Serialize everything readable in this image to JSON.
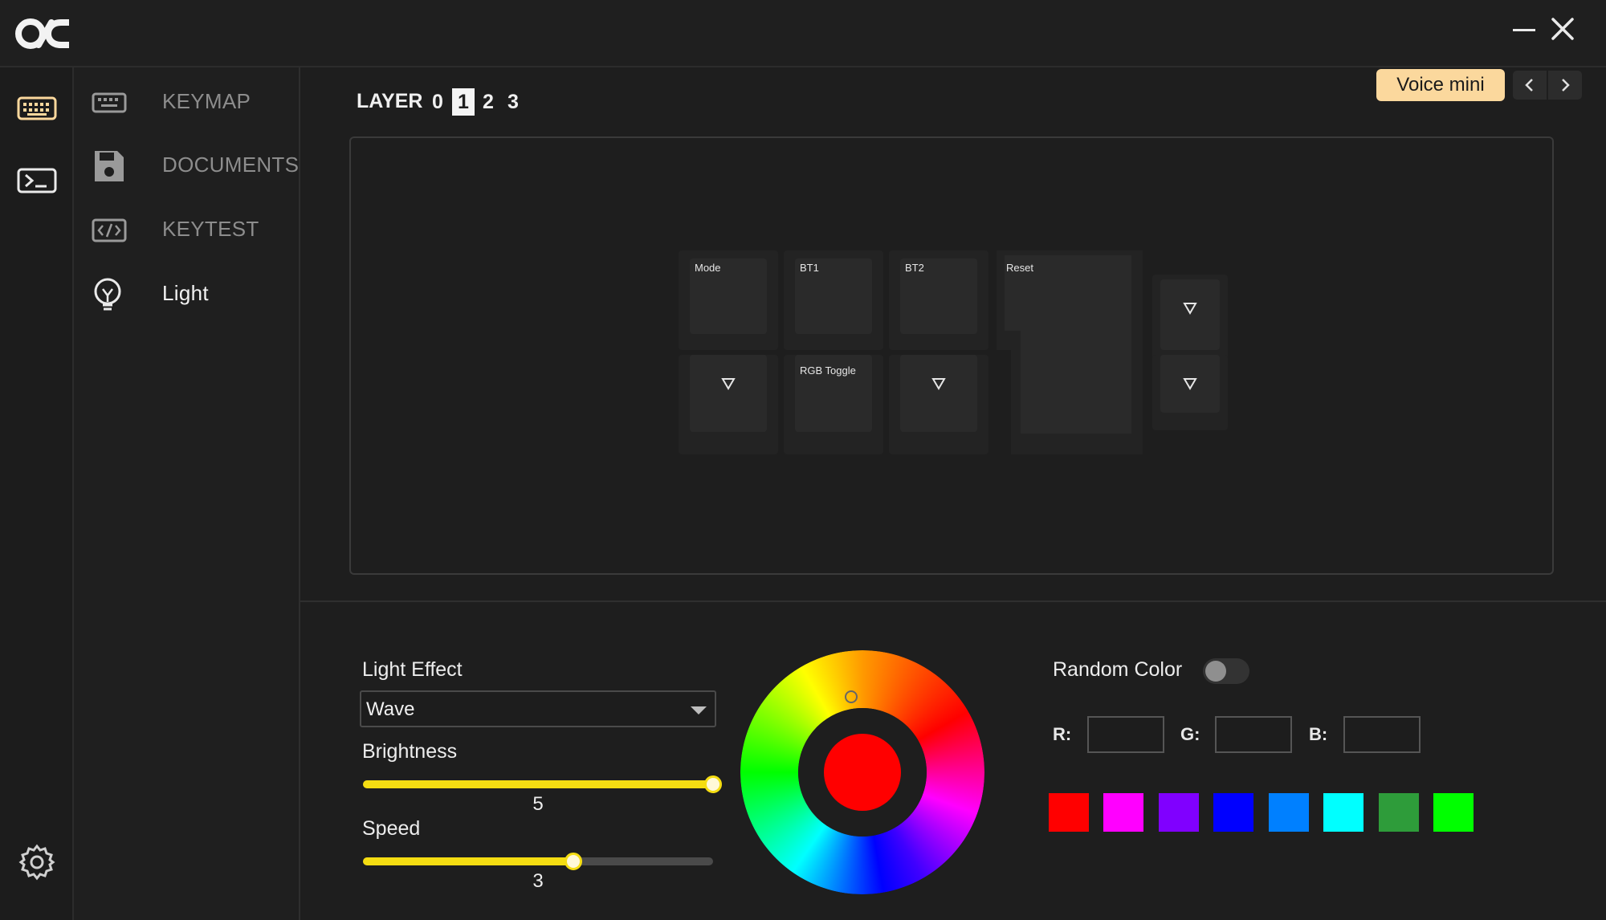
{
  "window": {
    "logo": "oc",
    "minimize_icon": "minimize-icon",
    "close_icon": "close-icon"
  },
  "rail": {
    "items": [
      {
        "icon": "keyboard-icon",
        "active": true
      },
      {
        "icon": "terminal-icon",
        "active": false
      }
    ],
    "settings_icon": "gear-icon"
  },
  "nav": {
    "items": [
      {
        "label": "KEYMAP",
        "icon": "keyboard-icon"
      },
      {
        "label": "DOCUMENTS",
        "icon": "save-icon"
      },
      {
        "label": "KEYTEST",
        "icon": "code-icon"
      },
      {
        "label": "Light",
        "icon": "bulb-icon",
        "active": true
      }
    ]
  },
  "layer": {
    "label": "LAYER",
    "tabs": [
      "0",
      "1",
      "2",
      "3"
    ],
    "active": "1"
  },
  "device": {
    "name": "Voice mini",
    "prev_icon": "chevron-left-icon",
    "next_icon": "chevron-right-icon"
  },
  "keys": {
    "mode": "Mode",
    "bt1": "BT1",
    "bt2": "BT2",
    "reset": "Reset",
    "rgb_toggle": "RGB Toggle",
    "transparent_icon": "triangle-down-icon"
  },
  "light": {
    "effect_label": "Light Effect",
    "effect_value": "Wave",
    "brightness_label": "Brightness",
    "brightness_value": "5",
    "brightness_fraction": 1.0,
    "speed_label": "Speed",
    "speed_value": "3",
    "speed_fraction": 0.6,
    "random_color_label": "Random Color",
    "random_color_on": false,
    "selected_color": "#ff0000",
    "r_label": "R:",
    "g_label": "G:",
    "b_label": "B:",
    "r_value": "",
    "g_value": "",
    "b_value": "",
    "swatches": [
      "#ff0000",
      "#ff00ff",
      "#8000ff",
      "#0000ff",
      "#0080ff",
      "#00ffff",
      "#2e9c3a",
      "#00ff00"
    ]
  },
  "colors": {
    "accent_yellow": "#f5dd12",
    "badge": "#fbd89d",
    "background": "#1e1e1e"
  }
}
